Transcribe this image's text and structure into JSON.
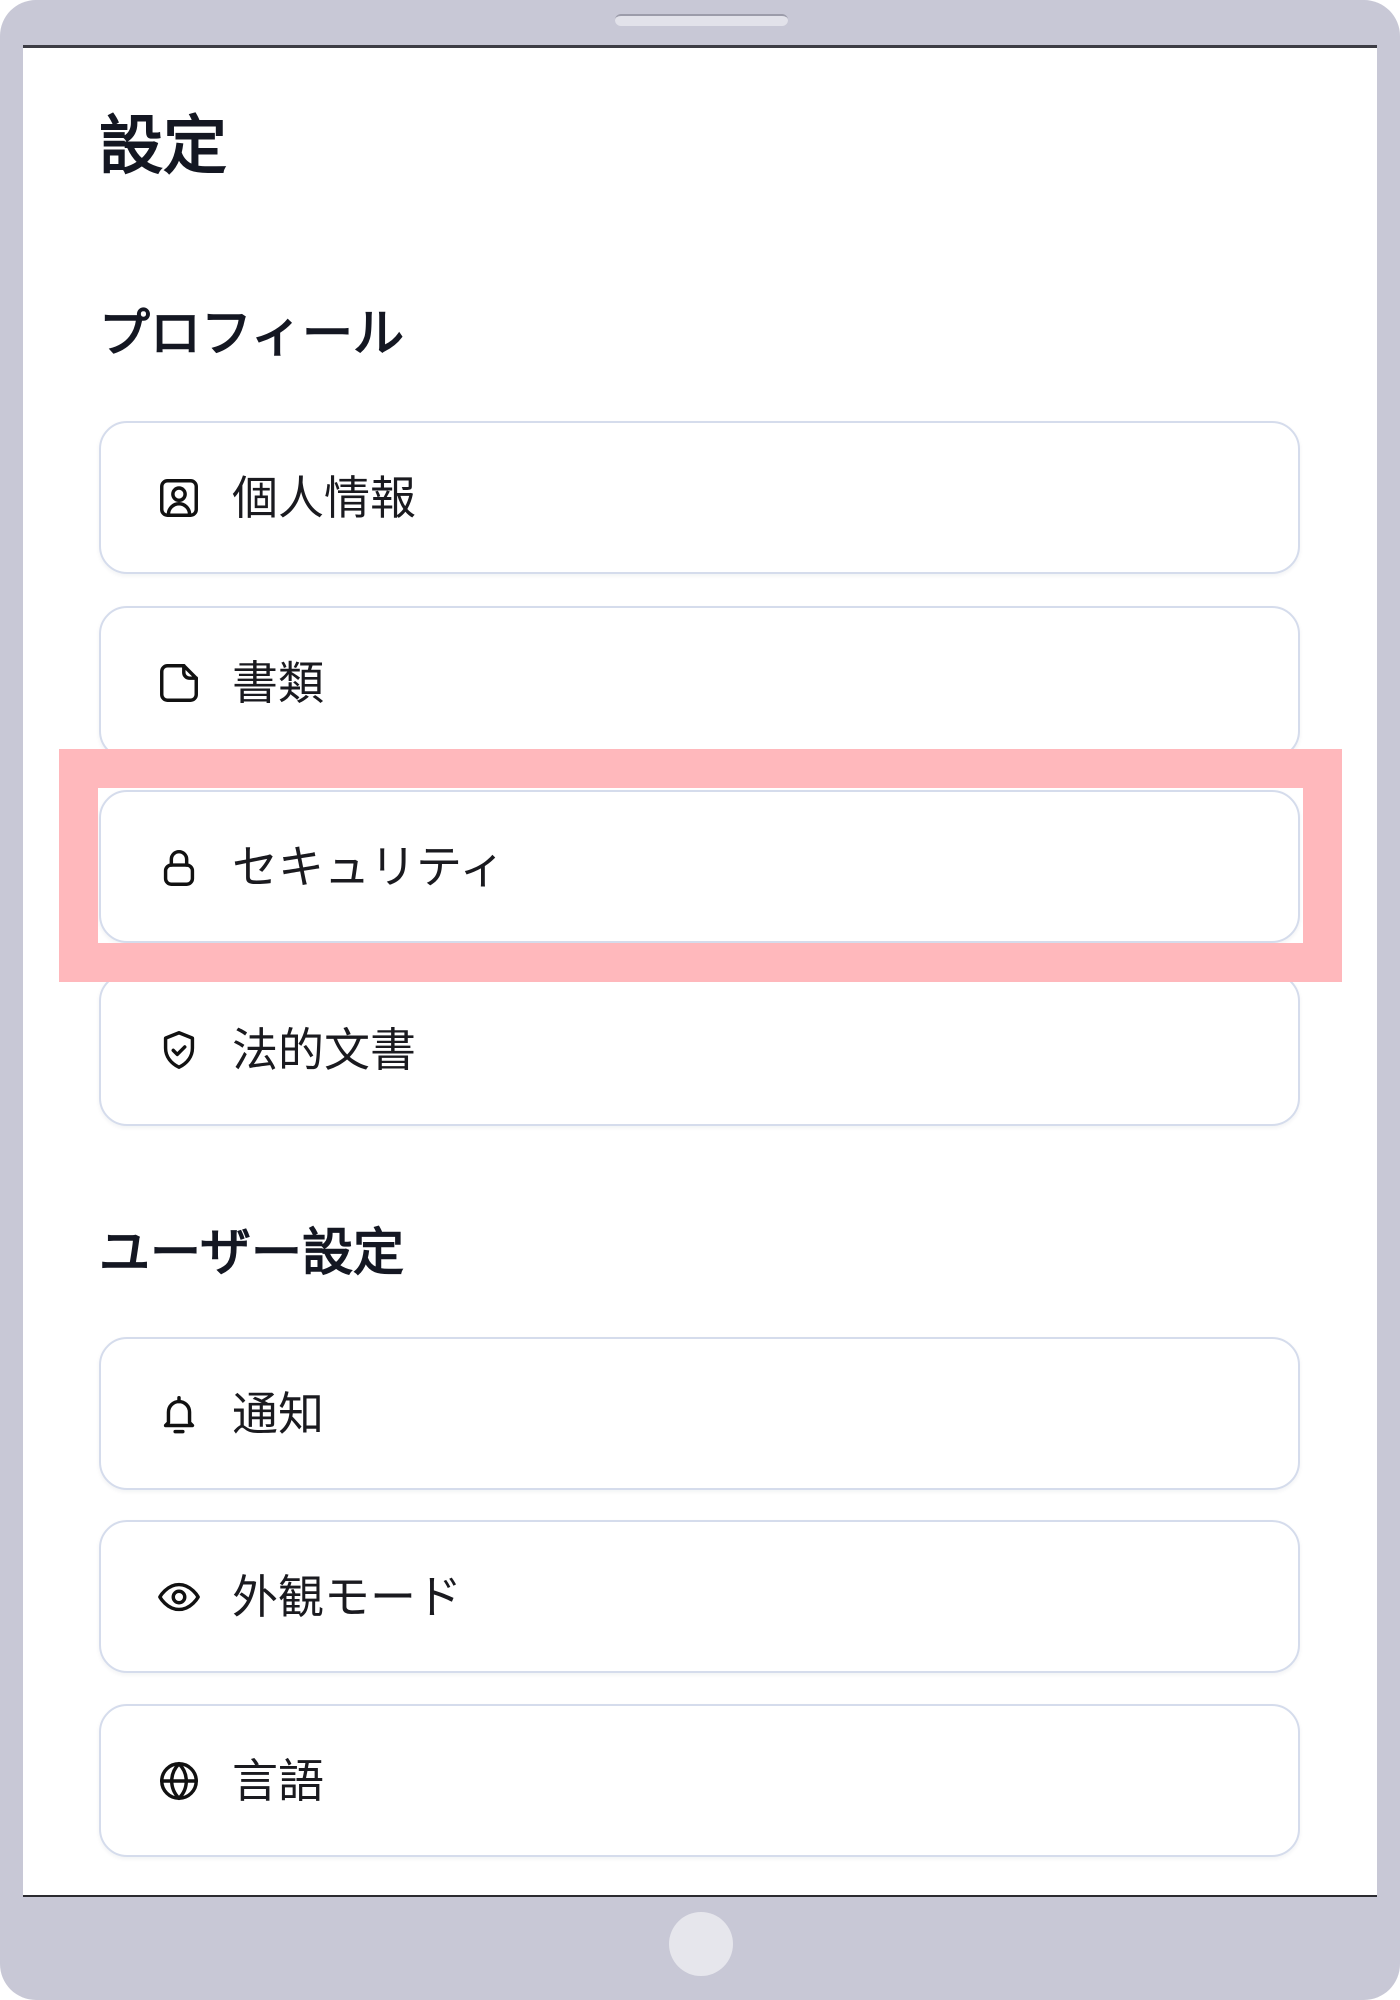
{
  "title": "設定",
  "profile": {
    "heading": "プロフィール",
    "items": [
      {
        "label": "個人情報",
        "icon": "user-square-icon",
        "highlighted": false
      },
      {
        "label": "書類",
        "icon": "file-icon",
        "highlighted": false
      },
      {
        "label": "セキュリティ",
        "icon": "lock-icon",
        "highlighted": true
      },
      {
        "label": "法的文書",
        "icon": "shield-check-icon",
        "highlighted": false
      }
    ]
  },
  "user_settings": {
    "heading": "ユーザー設定",
    "items": [
      {
        "label": "通知",
        "icon": "bell-icon"
      },
      {
        "label": "外観モード",
        "icon": "eye-icon"
      },
      {
        "label": "言語",
        "icon": "globe-icon"
      }
    ]
  },
  "colors": {
    "frame": "#c8c8d6",
    "highlight": "#ffb8bc",
    "text": "#141722",
    "card_border": "#d5dcec",
    "screen": "#ffffff"
  }
}
